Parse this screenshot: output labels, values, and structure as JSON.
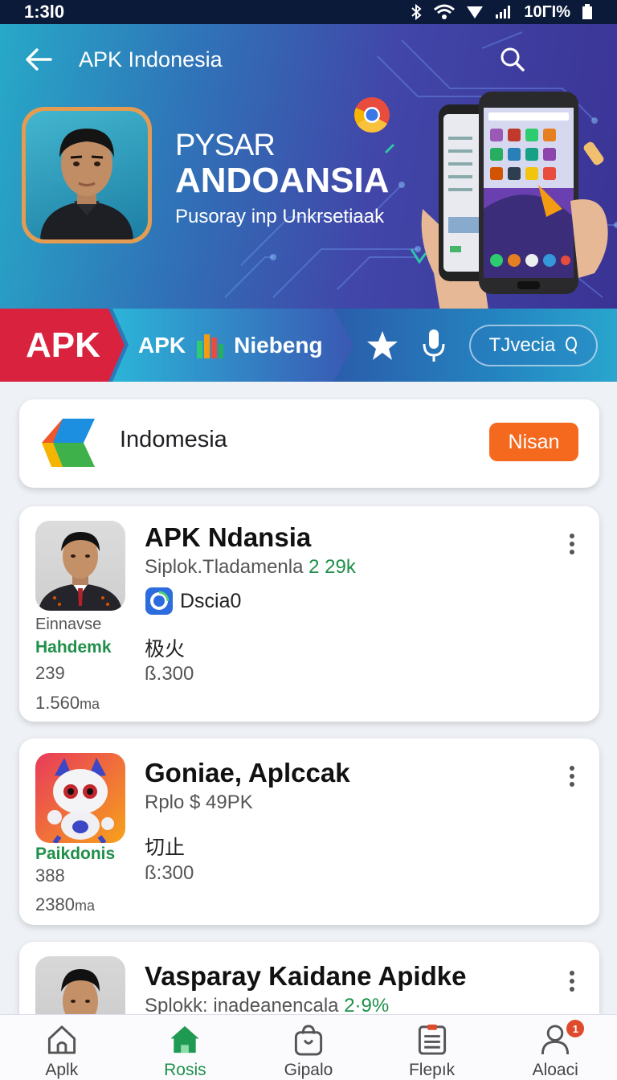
{
  "status_bar": {
    "time": "1:3l0",
    "battery": "10ΓΙ%"
  },
  "header": {
    "title": "APK Indonesia"
  },
  "hero": {
    "line1": "PYSAR",
    "line2": "ANDOANSIA",
    "line3": "Pusoray inp Unkrsetiaak"
  },
  "ribbon": {
    "apk_label": "APK",
    "apk_text": "APK",
    "niebeng": "Niebeng",
    "pill_label": "TJvecia"
  },
  "search_card": {
    "label": "Indomesia",
    "button": "Nisan"
  },
  "apps": [
    {
      "title": "APK Ndansia",
      "subtitle": "Siplok.Tladamenla",
      "subtitle_green": "2 29k",
      "dev": "Dscia0",
      "meta1": "Einnavse",
      "meta2": "Hahdemk",
      "meta3": "239",
      "meta4": "1.560",
      "meta4_unit": "ma",
      "cjk": "极火",
      "price": "ß.300"
    },
    {
      "title": "Goniae, Aplccak",
      "subtitle": "Rplo $ 49PK",
      "meta2": "Paikdonis",
      "meta3": "388",
      "meta4": "2380",
      "meta4_unit": "ma",
      "cjk": "切止",
      "price": "ß:300"
    },
    {
      "title": "Vasparay Kaidane Apidke",
      "subtitle": "Splokk: inadeanencala",
      "subtitle_green": "2·9%"
    }
  ],
  "bottom_nav": [
    {
      "label": "Aplk",
      "icon": "home-outline-icon"
    },
    {
      "label": "Rosis",
      "icon": "home-filled-icon",
      "active": true
    },
    {
      "label": "Gipalo",
      "icon": "bag-icon"
    },
    {
      "label": "Flepık",
      "icon": "clipboard-icon"
    },
    {
      "label": "Aloaci",
      "icon": "person-icon",
      "badge": "1"
    }
  ],
  "colors": {
    "accent_green": "#1f8f4a",
    "orange": "#f4691e",
    "red": "#d8223e"
  }
}
